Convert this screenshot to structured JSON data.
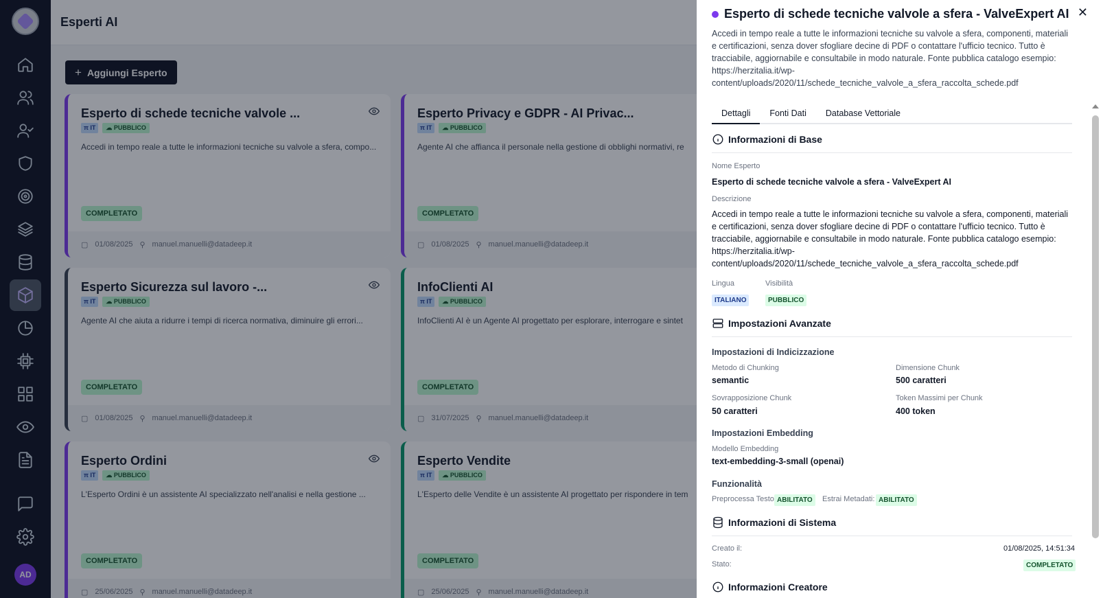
{
  "app": {
    "title": "Esperti AI",
    "add_button": "Aggiungi Esperto",
    "avatar": "AD"
  },
  "sidebar": {
    "items": [
      {
        "name": "home",
        "icon": "home-icon"
      },
      {
        "name": "users",
        "icon": "users-icon"
      },
      {
        "name": "user-check",
        "icon": "user-check-icon"
      },
      {
        "name": "shield",
        "icon": "shield-icon"
      },
      {
        "name": "target",
        "icon": "target-icon"
      },
      {
        "name": "layers",
        "icon": "layers-icon"
      },
      {
        "name": "database",
        "icon": "database-icon"
      },
      {
        "name": "experts",
        "icon": "cube-icon",
        "active": true
      },
      {
        "name": "analytics",
        "icon": "pie-chart-icon"
      },
      {
        "name": "chip",
        "icon": "cpu-icon"
      },
      {
        "name": "apps",
        "icon": "grid-icon"
      },
      {
        "name": "monitor",
        "icon": "eye-icon"
      },
      {
        "name": "documents",
        "icon": "file-text-icon"
      },
      {
        "name": "chat",
        "icon": "message-icon"
      },
      {
        "name": "settings",
        "icon": "gear-icon"
      }
    ]
  },
  "cards": [
    {
      "title": "Esperto di schede tecniche valvole ...",
      "lang": "IT",
      "visibility": "PUBBLICO",
      "desc": "Accedi in tempo reale a tutte le informazioni tecniche su valvole a sfera, compo...",
      "status": "COMPLETATO",
      "date": "01/08/2025",
      "user": "manuel.manuelli@datadeep.it",
      "color": "purple",
      "eye": true
    },
    {
      "title": "Esperto Privacy e GDPR - AI Privac...",
      "lang": "IT",
      "visibility": "PUBBLICO",
      "desc": "Agente AI che affianca il personale nella gestione di obblighi normativi, re",
      "status": "COMPLETATO",
      "date": "01/08/2025",
      "user": "manuel.manuelli@datadeep.it",
      "color": "purple",
      "eye": false
    },
    {
      "title": "Esperto Sicurezza sul lavoro -...",
      "lang": "IT",
      "visibility": "PUBBLICO",
      "desc": "Agente AI che aiuta a ridurre i tempi di ricerca normativa, diminuire gli errori...",
      "status": "COMPLETATO",
      "date": "01/08/2025",
      "user": "manuel.manuelli@datadeep.it",
      "color": "gray",
      "eye": true
    },
    {
      "title": "InfoClienti AI",
      "lang": "IT",
      "visibility": "PUBBLICO",
      "desc": "InfoClienti AI è un Agente AI progettato per esplorare, interrogare e sintet",
      "status": "COMPLETATO",
      "date": "31/07/2025",
      "user": "manuel.manuelli@datadeep.it",
      "color": "green",
      "eye": false
    },
    {
      "title": "Esperto Ordini",
      "lang": "IT",
      "visibility": "PUBBLICO",
      "desc": "L'Esperto Ordini è un assistente AI specializzato nell'analisi e nella gestione ...",
      "status": "COMPLETATO",
      "date": "25/06/2025",
      "user": "manuel.manuelli@datadeep.it",
      "color": "purple",
      "eye": true
    },
    {
      "title": "Esperto Vendite",
      "lang": "IT",
      "visibility": "PUBBLICO",
      "desc": "L'Esperto delle Vendite è un assistente AI progettato per rispondere in tem",
      "status": "COMPLETATO",
      "date": "25/06/2025",
      "user": "manuel.manuelli@datadeep.it",
      "color": "green",
      "eye": false
    }
  ],
  "panel": {
    "title": "Esperto di schede tecniche valvole a sfera - ValveExpert AI",
    "desc": "Accedi in tempo reale a tutte le informazioni tecniche su valvole a sfera, componenti, materiali e certificazioni, senza dover sfogliare decine di PDF o contattare l'ufficio tecnico. Tutto è tracciabile, aggiornabile e consultabile in modo naturale. Fonte pubblica catalogo esempio: https://herzitalia.it/wp-content/uploads/2020/11/schede_tecniche_valvole_a_sfera_raccolta_schede.pdf",
    "tabs": [
      "Dettagli",
      "Fonti Dati",
      "Database Vettoriale"
    ],
    "base": {
      "heading": "Informazioni di Base",
      "name_label": "Nome Esperto",
      "name_value": "Esperto di schede tecniche valvole a sfera - ValveExpert AI",
      "desc_label": "Descrizione",
      "desc_value": "Accedi in tempo reale a tutte le informazioni tecniche su valvole a sfera, componenti, materiali e certificazioni, senza dover sfogliare decine di PDF o contattare l'ufficio tecnico. Tutto è tracciabile, aggiornabile e consultabile in modo naturale. Fonte pubblica catalogo esempio: https://herzitalia.it/wp-content/uploads/2020/11/schede_tecniche_valvole_a_sfera_raccolta_schede.pdf",
      "lang_label": "Lingua",
      "lang_value": "ITALIANO",
      "vis_label": "Visibilità",
      "vis_value": "PUBBLICO"
    },
    "advanced": {
      "heading": "Impostazioni Avanzate",
      "index_heading": "Impostazioni di Indicizzazione",
      "chunk_method_label": "Metodo di Chunking",
      "chunk_method_value": "semantic",
      "chunk_size_label": "Dimensione Chunk",
      "chunk_size_value": "500 caratteri",
      "overlap_label": "Sovrapposizione Chunk",
      "overlap_value": "50 caratteri",
      "max_tokens_label": "Token Massimi per Chunk",
      "max_tokens_value": "400 token",
      "embedding_heading": "Impostazioni Embedding",
      "model_label": "Modello Embedding",
      "model_value": "text-embedding-3-small (openai)",
      "features_heading": "Funzionalità",
      "preprocess_label": "Preprocessa Testo:",
      "preprocess_value": "ABILITATO",
      "metadata_label": "Estrai Metadati:",
      "metadata_value": "ABILITATO"
    },
    "system": {
      "heading": "Informazioni di Sistema",
      "created_label": "Creato il:",
      "created_value": "01/08/2025, 14:51:34",
      "state_label": "Stato:",
      "state_value": "COMPLETATO"
    },
    "creator": {
      "heading": "Informazioni Creatore"
    }
  }
}
